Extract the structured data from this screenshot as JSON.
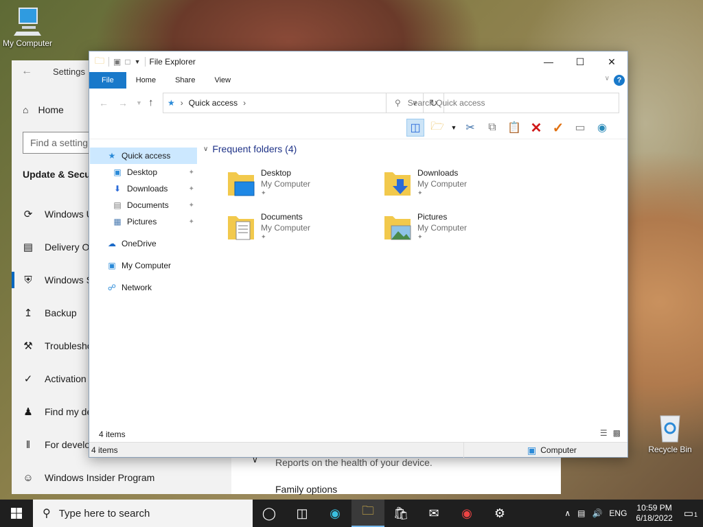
{
  "desktop": {
    "icons": [
      {
        "label": "My Computer"
      },
      {
        "label": "Recycle Bin"
      }
    ]
  },
  "settings": {
    "title": "Settings",
    "home": "Home",
    "find_placeholder": "Find a setting",
    "section": "Update & Secur",
    "nav": [
      {
        "label": "Windows U",
        "icon": "sync-icon"
      },
      {
        "label": "Delivery O",
        "icon": "delivery-icon"
      },
      {
        "label": "Windows S",
        "icon": "shield-icon"
      },
      {
        "label": "Backup",
        "icon": "backup-icon"
      },
      {
        "label": "Troublesho",
        "icon": "wrench-icon"
      },
      {
        "label": "Activation",
        "icon": "check-circle-icon"
      },
      {
        "label": "Find my de",
        "icon": "person-icon"
      },
      {
        "label": "For develo",
        "icon": "tools-icon"
      },
      {
        "label": "Windows Insider Program",
        "icon": "cat-icon"
      }
    ],
    "right": {
      "health_text": "Reports on the health of your device.",
      "family_options": "Family options"
    }
  },
  "explorer": {
    "title": "File Explorer",
    "tabs": [
      "File",
      "Home",
      "Share",
      "View"
    ],
    "help": "?",
    "address": "Quick access",
    "search_placeholder": "Search Quick access",
    "nav_pane": [
      {
        "label": "Quick access",
        "icon": "star-icon",
        "selected": true,
        "indent": false,
        "pinned": false
      },
      {
        "label": "Desktop",
        "icon": "desktop-icon",
        "selected": false,
        "indent": true,
        "pinned": true
      },
      {
        "label": "Downloads",
        "icon": "download-icon",
        "selected": false,
        "indent": true,
        "pinned": true
      },
      {
        "label": "Documents",
        "icon": "document-icon",
        "selected": false,
        "indent": true,
        "pinned": true
      },
      {
        "label": "Pictures",
        "icon": "picture-icon",
        "selected": false,
        "indent": true,
        "pinned": true
      },
      {
        "label": "OneDrive",
        "icon": "cloud-icon",
        "selected": false,
        "indent": false,
        "pinned": false
      },
      {
        "label": "My Computer",
        "icon": "computer-icon",
        "selected": false,
        "indent": false,
        "pinned": false
      },
      {
        "label": "Network",
        "icon": "network-icon",
        "selected": false,
        "indent": false,
        "pinned": false
      }
    ],
    "group_title": "Frequent folders (4)",
    "folders": [
      {
        "name": "Desktop",
        "location": "My Computer",
        "overlay": "desktop"
      },
      {
        "name": "Downloads",
        "location": "My Computer",
        "overlay": "download"
      },
      {
        "name": "Documents",
        "location": "My Computer",
        "overlay": "document"
      },
      {
        "name": "Pictures",
        "location": "My Computer",
        "overlay": "picture"
      }
    ],
    "item_count": "4 items",
    "status_left": "4 items",
    "status_right": "Computer"
  },
  "taskbar": {
    "search_placeholder": "Type here to search",
    "lang": "ENG",
    "time": "10:59 PM",
    "date": "6/18/2022",
    "notification_count": "1"
  },
  "colors": {
    "accent": "#1979ca",
    "selection": "#cce8ff",
    "taskbar": "#1f1f1f"
  }
}
